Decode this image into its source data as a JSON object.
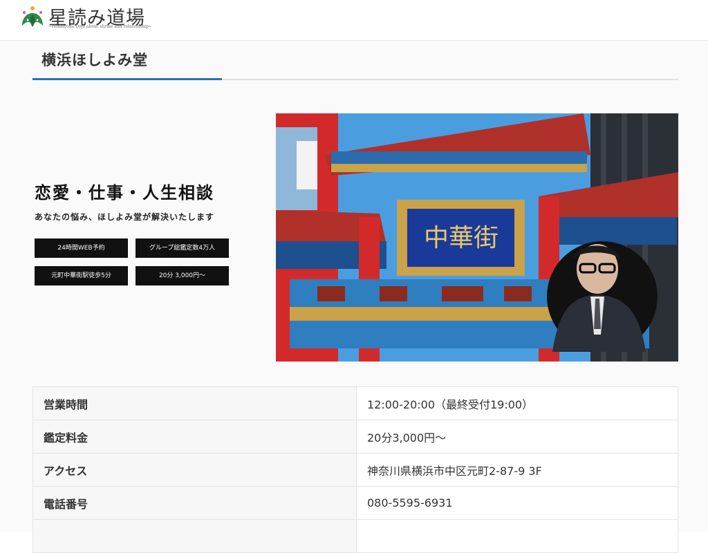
{
  "header": {
    "logo_title": "星読み道場",
    "logo_tagline": "~Hoshiyomi Dojo about shrine and relationship~"
  },
  "page": {
    "title": "横浜ほしよみ堂"
  },
  "hero": {
    "heading": "恋愛・仕事・人生相談",
    "subheading": "あなたの悩み、ほしよみ堂が解決いたします",
    "tags": [
      "24時間WEB予約",
      "グループ総鑑定数4万人",
      "元町中華街駅徒歩5分",
      "20分 3,000円〜"
    ],
    "image": {
      "sign_text": "中華街",
      "colors": {
        "sky": "#4a9ee0",
        "red": "#d22a2a",
        "blue": "#1a3a9a",
        "gold": "#c9a24a"
      }
    }
  },
  "info_table": {
    "rows": [
      {
        "key": "営業時間",
        "value": "12:00-20:00（最終受付19:00）"
      },
      {
        "key": "鑑定料金",
        "value": "20分3,000円〜"
      },
      {
        "key": "アクセス",
        "value": "神奈川県横浜市中区元町2-87-9 3F"
      },
      {
        "key": "電話番号",
        "value": "080-5595-6931"
      },
      {
        "key": "",
        "value": ""
      }
    ]
  },
  "colors": {
    "accent": "#2d6fb8",
    "tag_bg": "#111111"
  }
}
